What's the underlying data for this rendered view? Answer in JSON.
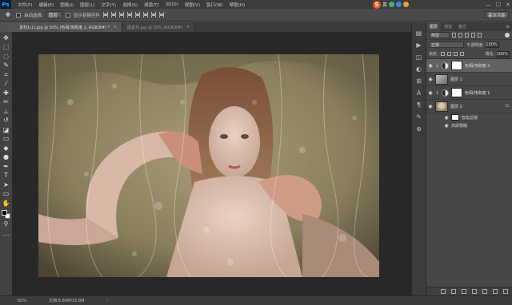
{
  "app": {
    "logo": "Ps"
  },
  "menu": [
    "文件(F)",
    "编辑(E)",
    "图像(I)",
    "图层(L)",
    "文字(Y)",
    "选择(S)",
    "滤镜(T)",
    "3D(D)",
    "视图(V)",
    "窗口(W)",
    "帮助(H)"
  ],
  "ime": {
    "logo": "S",
    "label": "英"
  },
  "window_controls": {
    "minimize": "—",
    "maximize": "☐",
    "close": "✕"
  },
  "options": {
    "auto_select": "自动选择:",
    "target": "图层",
    "show_transform": "显示变换控件",
    "workspace": "基本功能"
  },
  "tabs": [
    {
      "label": "素材1(1).jpg @ 50% (色相/饱和度 2, RGB/8#) *",
      "close": "×"
    },
    {
      "label": "图素材.jpg @ 50% (RGB/8#)",
      "close": "×"
    }
  ],
  "tools": [
    "move",
    "marquee",
    "lasso",
    "quick-select",
    "crop",
    "eyedropper",
    "healing",
    "brush",
    "clone",
    "history",
    "eraser",
    "gradient",
    "blur",
    "dodge",
    "pen",
    "text",
    "path-select",
    "shape",
    "hand",
    "zoom",
    "more"
  ],
  "tool_glyphs": {
    "move": "✥",
    "marquee": "⬚",
    "lasso": "◌",
    "quick-select": "✎",
    "crop": "⌗",
    "eyedropper": "⁄",
    "healing": "✚",
    "brush": "✏",
    "clone": "⊥",
    "history": "↺",
    "eraser": "◪",
    "gradient": "▭",
    "blur": "◆",
    "dodge": "●",
    "pen": "✒",
    "text": "T",
    "path-select": "➤",
    "shape": "▭",
    "hand": "✋",
    "zoom": "⚲",
    "more": "…"
  },
  "status": {
    "zoom": "50%",
    "doc": "文档:6.89M/15.8M",
    "arrow": "›"
  },
  "panel": {
    "tabs": [
      "图层",
      "通道",
      "路径"
    ],
    "menu": "≡",
    "kind": "类型",
    "blend": "正常",
    "opacity_label": "不透明度:",
    "opacity": "100%",
    "lock_label": "锁定:",
    "fill_label": "填充:",
    "fill": "100%",
    "layers": [
      {
        "name": "色相/饱和度 2",
        "type": "adjustment",
        "selected": true
      },
      {
        "name": "图层 1",
        "type": "pixel",
        "selected": false
      },
      {
        "name": "色相/饱和度 1",
        "type": "adjustment",
        "selected": false
      },
      {
        "name": "图层 2",
        "type": "photo",
        "selected": false
      }
    ],
    "sub": {
      "filters": "智能滤镜",
      "filter": "高斯模糊",
      "fx": "fx"
    }
  },
  "colors": {
    "photo_bg": "#8c8260",
    "panel": "#474747",
    "canvas": "#282828"
  }
}
